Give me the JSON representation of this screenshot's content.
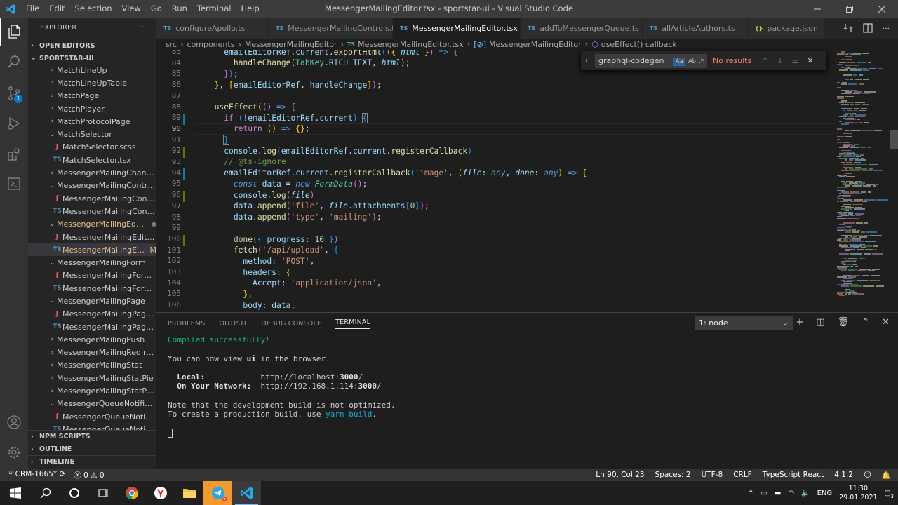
{
  "window": {
    "title": "MessengerMailingEditor.tsx - sportstar-ui - Visual Studio Code",
    "menu": [
      "File",
      "Edit",
      "Selection",
      "View",
      "Go",
      "Run",
      "Terminal",
      "Help"
    ]
  },
  "activity": {
    "scm_badge": "1"
  },
  "sidebar": {
    "header": "EXPLORER",
    "more": "···",
    "open_editors": "OPEN EDITORS",
    "project": "SPORTSTAR-UI",
    "items": [
      {
        "type": "folder",
        "open": false,
        "depth": 1,
        "label": "MatchLineUp"
      },
      {
        "type": "folder",
        "open": false,
        "depth": 1,
        "label": "MatchLineUpTable"
      },
      {
        "type": "folder",
        "open": false,
        "depth": 1,
        "label": "MatchPage"
      },
      {
        "type": "folder",
        "open": false,
        "depth": 1,
        "label": "MatchPlayer"
      },
      {
        "type": "folder",
        "open": false,
        "depth": 1,
        "label": "MatchProtocolPage"
      },
      {
        "type": "folder",
        "open": true,
        "depth": 1,
        "label": "MatchSelector"
      },
      {
        "type": "scss",
        "depth": 2,
        "label": "MatchSelector.scss"
      },
      {
        "type": "ts",
        "depth": 2,
        "label": "MatchSelector.tsx"
      },
      {
        "type": "folder",
        "open": false,
        "depth": 1,
        "label": "MessengerMailingChannels..."
      },
      {
        "type": "folder",
        "open": true,
        "depth": 1,
        "label": "MessengerMailingControls"
      },
      {
        "type": "scss",
        "depth": 2,
        "label": "MessengerMailingControl..."
      },
      {
        "type": "ts",
        "depth": 2,
        "label": "MessengerMailingControl..."
      },
      {
        "type": "folder",
        "open": true,
        "depth": 1,
        "label": "MessengerMailingEdi...",
        "modified_dot": "●"
      },
      {
        "type": "scss",
        "depth": 2,
        "label": "MessengerMailingEditor.s..."
      },
      {
        "type": "ts",
        "depth": 2,
        "label": "MessengerMailingEd...",
        "status": "M",
        "selected": true
      },
      {
        "type": "folder",
        "open": true,
        "depth": 1,
        "label": "MessengerMailingForm"
      },
      {
        "type": "scss",
        "depth": 2,
        "label": "MessengerMailingForm.scss"
      },
      {
        "type": "ts",
        "depth": 2,
        "label": "MessengerMailingForm.tsx"
      },
      {
        "type": "folder",
        "open": true,
        "depth": 1,
        "label": "MessengerMailingPage"
      },
      {
        "type": "scss",
        "depth": 2,
        "label": "MessengerMailingPage.scss"
      },
      {
        "type": "ts",
        "depth": 2,
        "label": "MessengerMailingPage.tsx"
      },
      {
        "type": "folder",
        "open": false,
        "depth": 1,
        "label": "MessengerMailingPush"
      },
      {
        "type": "folder",
        "open": false,
        "depth": 1,
        "label": "MessengerMailingRedirects..."
      },
      {
        "type": "folder",
        "open": false,
        "depth": 1,
        "label": "MessengerMailingStat"
      },
      {
        "type": "folder",
        "open": false,
        "depth": 1,
        "label": "MessengerMailingStatPie"
      },
      {
        "type": "folder",
        "open": false,
        "depth": 1,
        "label": "MessengerMailingStatProgr..."
      },
      {
        "type": "folder",
        "open": true,
        "depth": 1,
        "label": "MessengerQueueNotificati..."
      },
      {
        "type": "scss",
        "depth": 2,
        "label": "MessengerQueueNotificat..."
      },
      {
        "type": "ts",
        "depth": 2,
        "label": "MessengerQueueNotificat..."
      }
    ],
    "bottom_sections": [
      "NPM SCRIPTS",
      "OUTLINE",
      "TIMELINE"
    ]
  },
  "tabs": [
    {
      "icon": "TS",
      "label": "configureApollo.ts",
      "active": false
    },
    {
      "icon": "TS",
      "label": "MessengerMailingControls.tsx",
      "active": false
    },
    {
      "icon": "TS",
      "label": "MessengerMailingEditor.tsx",
      "active": true
    },
    {
      "icon": "TS",
      "label": "addToMessengerQueue.ts",
      "active": false
    },
    {
      "icon": "TS",
      "label": "allArticleAuthors.ts",
      "active": false
    },
    {
      "icon": "{}",
      "label": "package.json",
      "active": false
    }
  ],
  "breadcrumb": [
    "src",
    "components",
    "MessengerMailingEditor",
    "MessengerMailingEditor.tsx",
    "MessengerMailingEditor",
    "useEffect() callback"
  ],
  "find": {
    "query": "graphql-codegen",
    "opt_case": "Aa",
    "opt_word": "Ab",
    "opt_regex": ".*",
    "result": "No results"
  },
  "editor": {
    "line_numbers": [
      "83",
      "84",
      "85",
      "86",
      "87",
      "88",
      "89",
      "90",
      "91",
      "92",
      "93",
      "94",
      "95",
      "96",
      "97",
      "98",
      "99",
      "100",
      "101",
      "102",
      "103",
      "104",
      "105",
      "106"
    ],
    "current_line": "90"
  },
  "panel": {
    "tabs": [
      "PROBLEMS",
      "OUTPUT",
      "DEBUG CONSOLE",
      "TERMINAL"
    ],
    "active_tab": "TERMINAL",
    "terminal_select": "1: node",
    "terminal": {
      "compiled": "Compiled successfully!",
      "view_prefix": "You can now view ",
      "app": "ui",
      "view_suffix": " in the browser.",
      "local_label": "  Local:",
      "local_url_pre": "http://localhost:",
      "local_port": "3000",
      "network_label": "  On Your Network:",
      "network_url_pre": "http://192.168.1.114:",
      "network_port": "3000",
      "note": "Note that the development build is not optimized.",
      "prod_pre": "To create a production build, use ",
      "prod_cmd": "yarn build",
      "prod_post": "."
    }
  },
  "status": {
    "branch": "CRM-1665*",
    "errors": "0",
    "warnings": "0",
    "position": "Ln 90, Col 23",
    "spaces": "Spaces: 2",
    "encoding": "UTF-8",
    "eol": "CRLF",
    "language": "TypeScript React",
    "version": "4.1.2"
  },
  "taskbar": {
    "lang": "ENG",
    "time": "11:30",
    "date": "29.01.2021",
    "notifications": "3",
    "telegram_badge": "6"
  },
  "colors": {
    "accent": "#007acc",
    "titlebar": "#3c3c3c",
    "sidebar": "#252526",
    "editor": "#1e1e1e",
    "statusbar": "#333333"
  }
}
